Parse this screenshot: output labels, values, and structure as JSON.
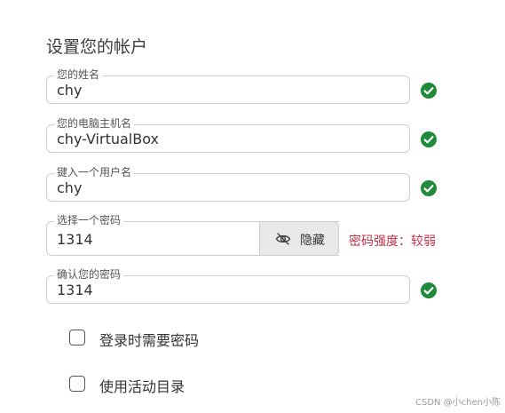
{
  "page": {
    "title": "设置您的帐户"
  },
  "fields": {
    "name": {
      "label": "您的姓名",
      "value": "chy",
      "valid": true
    },
    "hostname": {
      "label": "您的电脑主机名",
      "value": "chy-VirtualBox",
      "valid": true
    },
    "username": {
      "label": "键入一个用户名",
      "value": "chy",
      "valid": true
    },
    "password": {
      "label": "选择一个密码",
      "value": "1314"
    },
    "confirm_password": {
      "label": "确认您的密码",
      "value": "1314",
      "valid": true
    }
  },
  "password_toggle": {
    "label": "隐藏",
    "icon": "eye-hidden-icon"
  },
  "password_strength": {
    "text": "密码强度：较弱",
    "color": "#c0304b"
  },
  "options": {
    "require_password": {
      "label": "登录时需要密码",
      "checked": false
    },
    "active_directory": {
      "label": "使用活动目录",
      "checked": false
    }
  },
  "watermark": {
    "text": "CSDN @小chen小陈"
  },
  "colors": {
    "valid_check": "#1e8a3a",
    "field_border": "#cfcfcf",
    "toggle_background": "#e9e9e9"
  }
}
